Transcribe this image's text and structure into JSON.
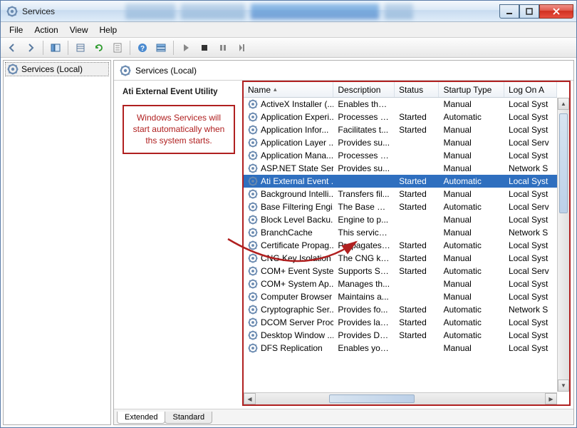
{
  "window": {
    "title": "Services"
  },
  "menubar": [
    "File",
    "Action",
    "View",
    "Help"
  ],
  "toolbar_icons": [
    "back",
    "forward",
    "up-level",
    "show-hide",
    "export",
    "refresh",
    "properties",
    "help",
    "filter",
    "play",
    "stop",
    "pause",
    "restart"
  ],
  "tree": {
    "root": "Services (Local)"
  },
  "header": {
    "title": "Services (Local)"
  },
  "detail": {
    "selected_name": "Ati External Event Utility",
    "annotation": "Windows Services will start automatically when ths system starts."
  },
  "columns": [
    {
      "key": "name",
      "label": "Name",
      "sort": true
    },
    {
      "key": "desc",
      "label": "Description"
    },
    {
      "key": "status",
      "label": "Status"
    },
    {
      "key": "startup",
      "label": "Startup Type"
    },
    {
      "key": "logon",
      "label": "Log On A"
    }
  ],
  "services": [
    {
      "name": "ActiveX Installer (...",
      "desc": "Enables the ...",
      "status": "",
      "startup": "Manual",
      "logon": "Local Syst"
    },
    {
      "name": "Application Experi...",
      "desc": "Processes a...",
      "status": "Started",
      "startup": "Automatic",
      "logon": "Local Syst"
    },
    {
      "name": "Application Infor...",
      "desc": "Facilitates t...",
      "status": "Started",
      "startup": "Manual",
      "logon": "Local Syst"
    },
    {
      "name": "Application Layer ...",
      "desc": "Provides su...",
      "status": "",
      "startup": "Manual",
      "logon": "Local Serv"
    },
    {
      "name": "Application Mana...",
      "desc": "Processes in...",
      "status": "",
      "startup": "Manual",
      "logon": "Local Syst"
    },
    {
      "name": "ASP.NET State Ser...",
      "desc": "Provides su...",
      "status": "",
      "startup": "Manual",
      "logon": "Network S"
    },
    {
      "name": "Ati External Event ...",
      "desc": "",
      "status": "Started",
      "startup": "Automatic",
      "logon": "Local Syst",
      "selected": true
    },
    {
      "name": "Background Intelli...",
      "desc": "Transfers fil...",
      "status": "Started",
      "startup": "Manual",
      "logon": "Local Syst"
    },
    {
      "name": "Base Filtering Engi...",
      "desc": "The Base Fil...",
      "status": "Started",
      "startup": "Automatic",
      "logon": "Local Serv"
    },
    {
      "name": "Block Level Backu...",
      "desc": "Engine to p...",
      "status": "",
      "startup": "Manual",
      "logon": "Local Syst"
    },
    {
      "name": "BranchCache",
      "desc": "This service ...",
      "status": "",
      "startup": "Manual",
      "logon": "Network S"
    },
    {
      "name": "Certificate Propag...",
      "desc": "Propagates ...",
      "status": "Started",
      "startup": "Automatic",
      "logon": "Local Syst"
    },
    {
      "name": "CNG Key Isolation",
      "desc": "The CNG ke...",
      "status": "Started",
      "startup": "Manual",
      "logon": "Local Syst"
    },
    {
      "name": "COM+ Event Syste...",
      "desc": "Supports Sy...",
      "status": "Started",
      "startup": "Automatic",
      "logon": "Local Serv"
    },
    {
      "name": "COM+ System Ap...",
      "desc": "Manages th...",
      "status": "",
      "startup": "Manual",
      "logon": "Local Syst"
    },
    {
      "name": "Computer Browser",
      "desc": "Maintains a...",
      "status": "",
      "startup": "Manual",
      "logon": "Local Syst"
    },
    {
      "name": "Cryptographic Ser...",
      "desc": "Provides fo...",
      "status": "Started",
      "startup": "Automatic",
      "logon": "Network S"
    },
    {
      "name": "DCOM Server Proc...",
      "desc": "Provides lau...",
      "status": "Started",
      "startup": "Automatic",
      "logon": "Local Syst"
    },
    {
      "name": "Desktop Window ...",
      "desc": "Provides De...",
      "status": "Started",
      "startup": "Automatic",
      "logon": "Local Syst"
    },
    {
      "name": "DFS Replication",
      "desc": "Enables you...",
      "status": "",
      "startup": "Manual",
      "logon": "Local Syst"
    }
  ],
  "tabs": {
    "extended": "Extended",
    "standard": "Standard",
    "active": "extended"
  }
}
